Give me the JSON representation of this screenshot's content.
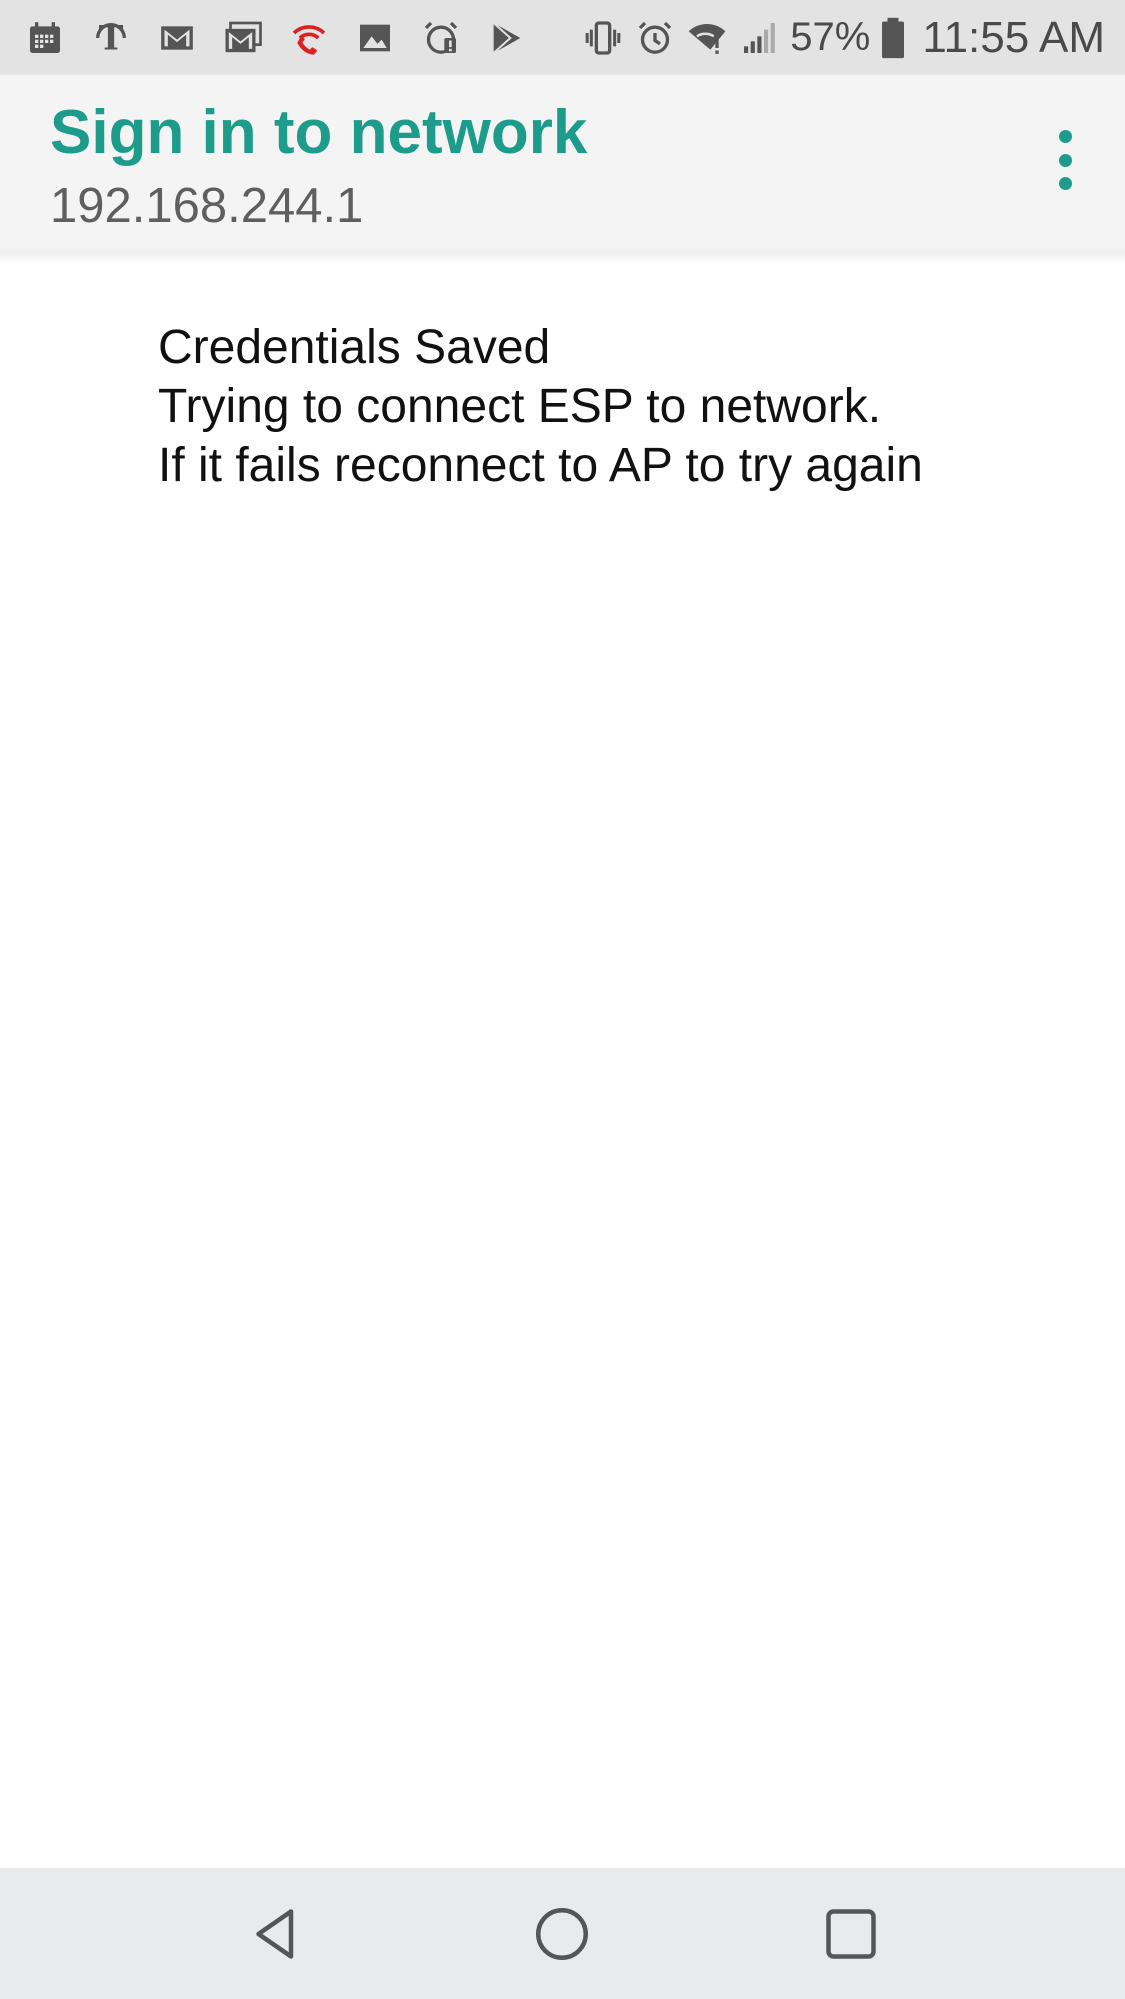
{
  "status_bar": {
    "notification_icons": [
      "calendar-icon",
      "nytimes-icon",
      "gmail-icon",
      "gmail-stack-icon",
      "wifi-calling-icon",
      "image-icon",
      "alarm-alert-icon",
      "play-store-icon"
    ],
    "system_icons": [
      "vibrate-icon",
      "alarm-icon",
      "wifi-alert-icon",
      "signal-icon",
      "battery-icon"
    ],
    "battery_percent": "57%",
    "time": "11:55 AM"
  },
  "app_bar": {
    "title": "Sign in to network",
    "subtitle": "192.168.244.1",
    "menu_icon": "more-vert-icon"
  },
  "content": {
    "lines": [
      "Credentials Saved",
      "Trying to connect ESP to network.",
      "If it fails reconnect to AP to try again"
    ]
  },
  "nav_bar": {
    "buttons": [
      "back-icon",
      "home-icon",
      "recents-icon"
    ]
  },
  "colors": {
    "accent": "#1d9c8c",
    "status_bar_bg": "#e3e3e3",
    "app_bar_bg": "#f4f4f4",
    "nav_bar_bg": "#e9eaec",
    "wifi_calling_red": "#e02020"
  }
}
